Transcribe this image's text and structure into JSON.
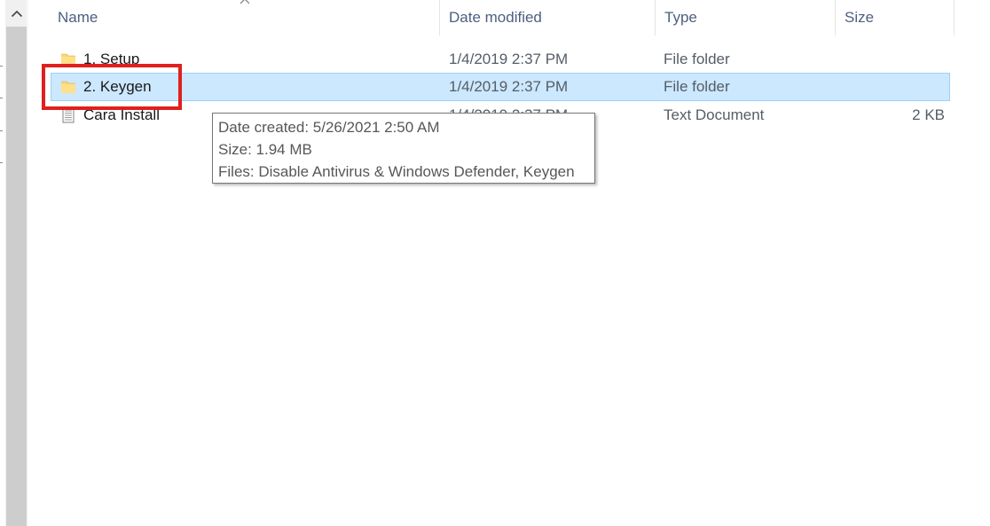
{
  "columns": {
    "name": "Name",
    "date_modified": "Date modified",
    "type": "Type",
    "size": "Size"
  },
  "sort": {
    "column": "name",
    "icon": "sort-ascending-caret-icon"
  },
  "files": [
    {
      "name": "1. Setup",
      "date": "1/4/2019 2:37 PM",
      "type": "File folder",
      "size": "",
      "icon": "folder-icon",
      "selected": false
    },
    {
      "name": "2. Keygen",
      "date": "1/4/2019 2:37 PM",
      "type": "File folder",
      "size": "",
      "icon": "folder-icon",
      "selected": true
    },
    {
      "name": "Cara Install",
      "date": "1/4/2019 2:37 PM",
      "type": "Text Document",
      "size": "2 KB",
      "icon": "text-document-icon",
      "selected": false
    }
  ],
  "tooltip": {
    "date_created": "Date created: 5/26/2021 2:50 AM",
    "size": "Size: 1.94 MB",
    "files": "Files: Disable Antivirus & Windows Defender, Keygen"
  },
  "annotation": {
    "color": "#e0201e",
    "target": "2. Keygen"
  },
  "colors": {
    "selection_fill": "#cce8ff",
    "selection_border": "#99d1ff",
    "header_text": "#4d6080",
    "folder_yellow": "#f8d775"
  }
}
